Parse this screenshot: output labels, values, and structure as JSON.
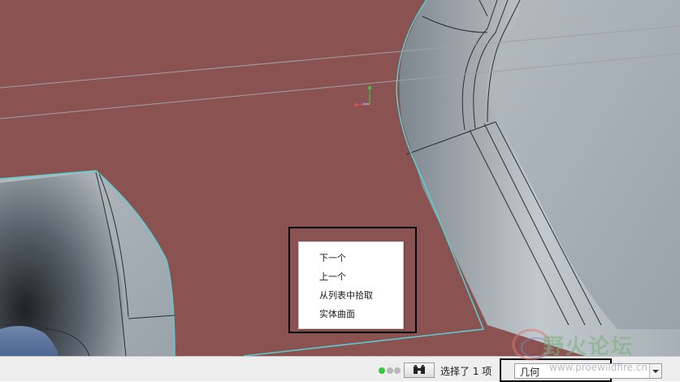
{
  "context_menu": {
    "items": [
      "下一个",
      "上一个",
      "从列表中拾取",
      "实体曲面"
    ]
  },
  "status_bar": {
    "selection_text": "选择了 1 项",
    "filter_value": "几何",
    "find_icon": "binoculars-icon",
    "status_lights": [
      "green",
      "gray",
      "gray"
    ]
  },
  "watermark": {
    "text": "野火论坛",
    "url": "www.proewildfire.cn"
  },
  "colors": {
    "face_highlight": "#8b5252",
    "model_surface": "#a4adb3",
    "edge_highlight": "#5ad0d0"
  }
}
